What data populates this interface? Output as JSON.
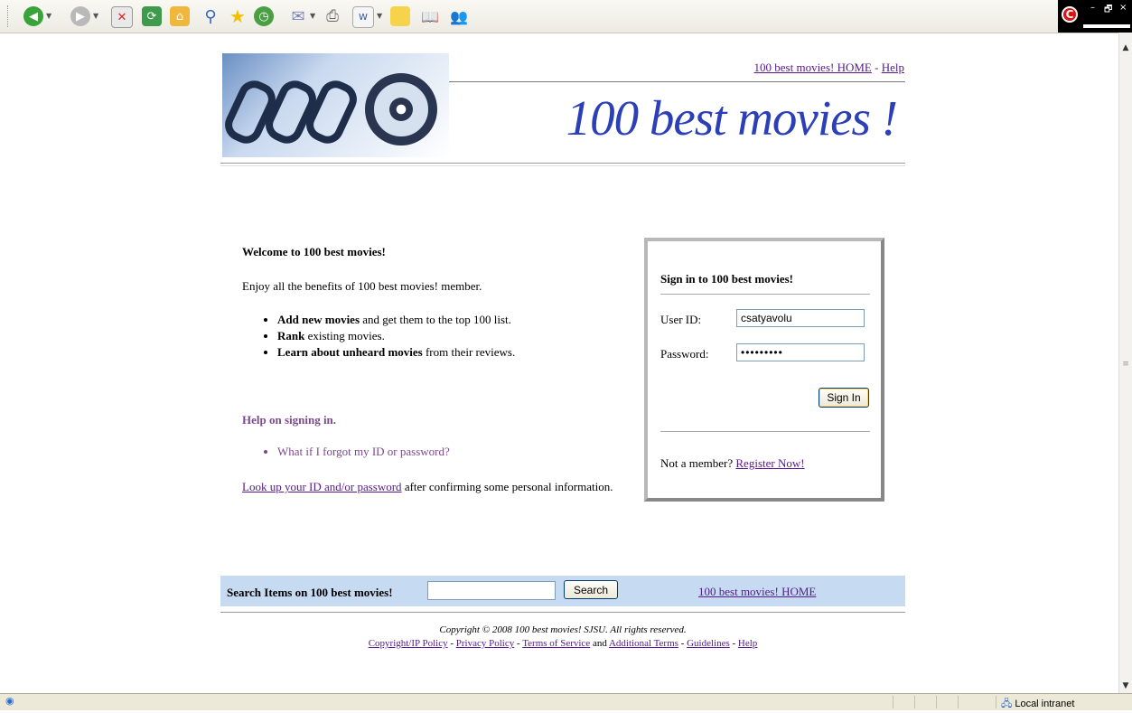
{
  "toolbar": {
    "icons": [
      "back-icon",
      "forward-icon",
      "stop-icon",
      "refresh-icon",
      "home-icon",
      "search-icon",
      "favorites-icon",
      "history-icon",
      "mail-icon",
      "print-icon",
      "edit-icon",
      "notes-icon",
      "research-icon",
      "messenger-icon"
    ]
  },
  "header": {
    "home_link": "100 best movies! HOME",
    "separator": " - ",
    "help_link": "Help",
    "title": "100 best movies !"
  },
  "welcome": {
    "title": "Welcome to 100 best movies!",
    "intro": "Enjoy all the benefits of 100 best movies! member.",
    "benefits": [
      {
        "bold": "Add new movies",
        "rest": " and get them to the top 100 list."
      },
      {
        "bold": "Rank",
        "rest": " existing movies."
      },
      {
        "bold": "Learn about unheard movies",
        "rest": " from their reviews."
      }
    ],
    "help_title": "Help on signing in.",
    "help_item": "What if I forgot my ID or password?",
    "lookup_link": "Look up your ID and/or password",
    "lookup_rest": " after confirming some personal information."
  },
  "signin": {
    "title": "Sign in to 100 best movies!",
    "userid_label": "User ID:",
    "userid_value": "csatyavolu",
    "password_label": "Password:",
    "password_value": "•••••••••",
    "button": "Sign In",
    "not_member": "Not a member? ",
    "register_link": "Register Now!"
  },
  "search": {
    "label": "Search Items on 100 best movies!",
    "button": "Search",
    "home_link": "100 best movies! HOME"
  },
  "footer": {
    "copyright": "Copyright © 2008 100 best movies! SJSU. All rights reserved.",
    "links": [
      "Copyright/IP Policy",
      "Privacy Policy",
      "Terms of Service",
      "Additional Terms",
      "Guidelines",
      "Help"
    ],
    "and": " and "
  },
  "statusbar": {
    "zone": "Local intranet"
  },
  "window": {
    "minimize": "–",
    "restore": "🗗",
    "close": "×"
  }
}
